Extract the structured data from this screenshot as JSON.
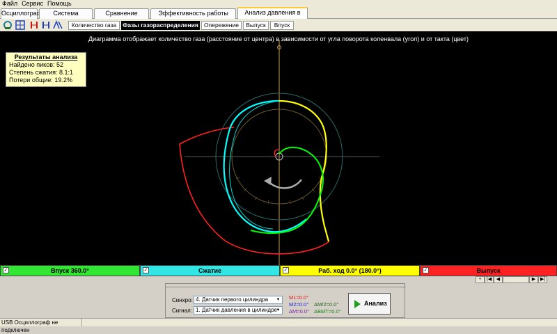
{
  "menu": [
    "Файл",
    "Сервис",
    "Помощь"
  ],
  "main_tabs": [
    "Осциллограф",
    "Система зажигания",
    "Сравнение цилиндров",
    "Эффективность работы цилиндров",
    "Анализ давления в цилиндре"
  ],
  "sub_tabs": [
    "Количество газа",
    "Фазы газораспределения",
    "Опережение",
    "Выпуск",
    "Впуск"
  ],
  "plot": {
    "title": "Диаграмма отображает количество газа (расстояние от центра) в зависимости от угла поворота коленвала (угол) и от такта (цвет)",
    "colors": {
      "intake": "#00ff00",
      "compression": "#00ffff",
      "power": "#ffff00",
      "exhaust": "#ff0000",
      "background": "#000000"
    }
  },
  "results": {
    "title": "Результаты анализа",
    "peaks": "Найдено пиков: 52",
    "compression": "Степень сжатия: 8.1:1",
    "losses": "Потери общие: 19.2%"
  },
  "phases": [
    {
      "label": "Впуск 360.0°",
      "color": "#33e633",
      "checked": true
    },
    {
      "label": "Сжатие",
      "color": "#33e6e6",
      "checked": true
    },
    {
      "label": "Раб. ход 0.0° (180.0°)",
      "color": "#ffff00",
      "checked": true
    },
    {
      "label": "Выпуск",
      "color": "#ff2222",
      "checked": true
    }
  ],
  "controls": {
    "sync_label": "Синхро:",
    "sync_value": "4.  Датчик первого цилиндра",
    "signal_label": "Сигнал:",
    "signal_value": "1.  Датчик давления в цилиндре",
    "m1": "M1=0.0°",
    "m2": "M2=0.0°",
    "dm": "ΔM=0.0°",
    "dm2": "ΔM/2=0.0°",
    "dmvmt": "ΔВМТ=0.0°",
    "analyze_label": "Анализ"
  },
  "status": "USB Осциллограф не подключен"
}
